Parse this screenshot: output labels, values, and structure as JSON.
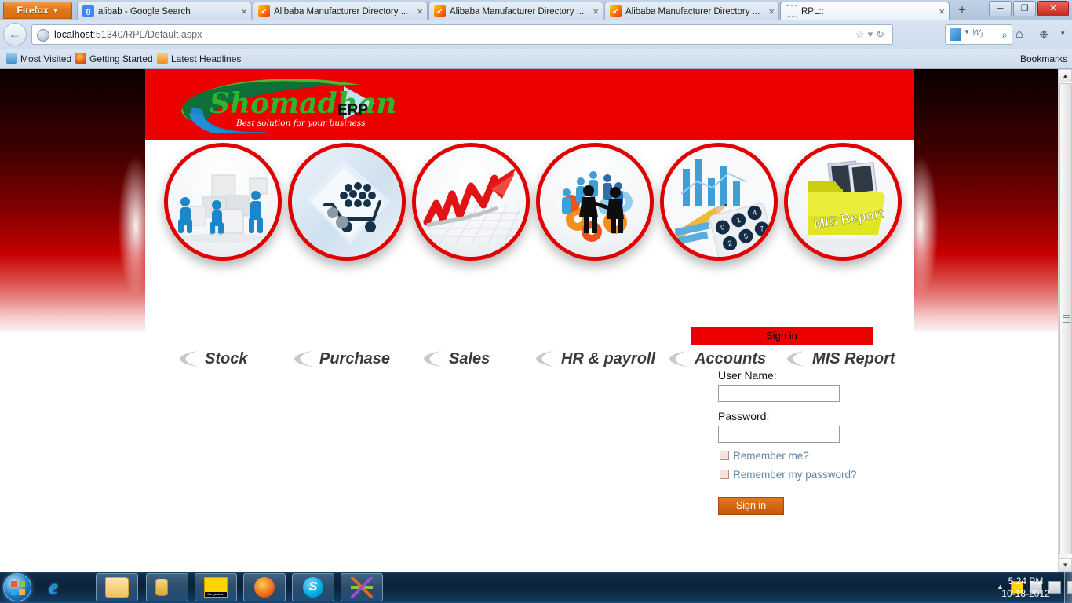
{
  "browser": {
    "app_button": "Firefox",
    "tabs": [
      {
        "title": "alibab - Google Search",
        "favicon": "google-icon",
        "active": false,
        "close": "×"
      },
      {
        "title": "Alibaba Manufacturer Directory ...",
        "favicon": "alibaba-icon",
        "active": false,
        "close": "×"
      },
      {
        "title": "Alibaba Manufacturer Directory ...",
        "favicon": "alibaba-icon",
        "active": false,
        "close": "×"
      },
      {
        "title": "Alibaba Manufacturer Directory ...",
        "favicon": "alibaba-icon",
        "active": false,
        "close": "×"
      },
      {
        "title": "RPL::",
        "favicon": "blank-page-icon",
        "active": true,
        "close": "×"
      }
    ],
    "new_tab": "+",
    "window_controls": {
      "minimize": "─",
      "restore": "❐",
      "close": "✕"
    },
    "back_arrow": "←",
    "url_host": "localhost",
    "url_path": ":51340/RPL/Default.aspx",
    "url_icons": {
      "star": "☆",
      "caret": "▾",
      "reload": "↻"
    },
    "search_engine_label": "W₁",
    "search_magnifier": "⌕",
    "home_icon": "⌂",
    "toolbar_caret": "▾",
    "bookmarks": [
      {
        "label": "Most Visited",
        "icon": "most-visited-icon"
      },
      {
        "label": "Getting Started",
        "icon": "firefox-icon"
      },
      {
        "label": "Latest Headlines",
        "icon": "rss-icon"
      }
    ],
    "bookmarks_button": "Bookmarks"
  },
  "site": {
    "logo": {
      "name": "Shomadhan",
      "suffix": "ERP",
      "tagline": "Best solution for your business"
    },
    "modules": [
      {
        "label": "Stock",
        "icon": "warehouse-boxes-icon"
      },
      {
        "label": "Purchase",
        "icon": "shopping-cart-key-icon"
      },
      {
        "label": "Sales",
        "icon": "rising-arrow-chart-icon"
      },
      {
        "label": "HR & payroll",
        "icon": "people-gears-icon"
      },
      {
        "label": "Accounts",
        "icon": "calculator-chart-pencil-icon"
      },
      {
        "label": "MIS Report",
        "icon": "yellow-folder-icon"
      }
    ],
    "mis_folder_text": "MIS Report",
    "signin": {
      "panel_title": "Sign in",
      "username_label": "User Name:",
      "username_value": "",
      "username_placeholder": "",
      "password_label": "Password:",
      "password_value": "",
      "password_placeholder": "",
      "remember_me": "Remember me?",
      "remember_password": "Remember my password?",
      "submit_label": "Sign in"
    },
    "colors": {
      "brand_red": "#ec0000",
      "button_orange": "#d4600f",
      "link_blue": "#5f87a6"
    }
  },
  "scrollbar": {
    "up": "▲",
    "down": "▼"
  },
  "taskbar": {
    "start": "start-orb",
    "items": [
      {
        "name": "internet-explorer-icon",
        "glyph": "e"
      },
      {
        "name": "windows-explorer-icon",
        "glyph": ""
      },
      {
        "name": "sql-server-tools-icon",
        "glyph": ""
      },
      {
        "name": "bangladesh-app-icon",
        "glyph": "Bangladesh"
      },
      {
        "name": "firefox-icon",
        "glyph": ""
      },
      {
        "name": "skype-icon",
        "glyph": "S"
      },
      {
        "name": "visual-studio-icon",
        "glyph": ""
      }
    ],
    "tray_arrow": "▲",
    "tray_icons": [
      "bangladesh-tray-icon",
      "action-center-icon",
      "network-error-icon",
      "removable-media-icon",
      "display-icon",
      "volume-icon"
    ],
    "time": "5:24 PM",
    "date": "10-18-2012"
  }
}
